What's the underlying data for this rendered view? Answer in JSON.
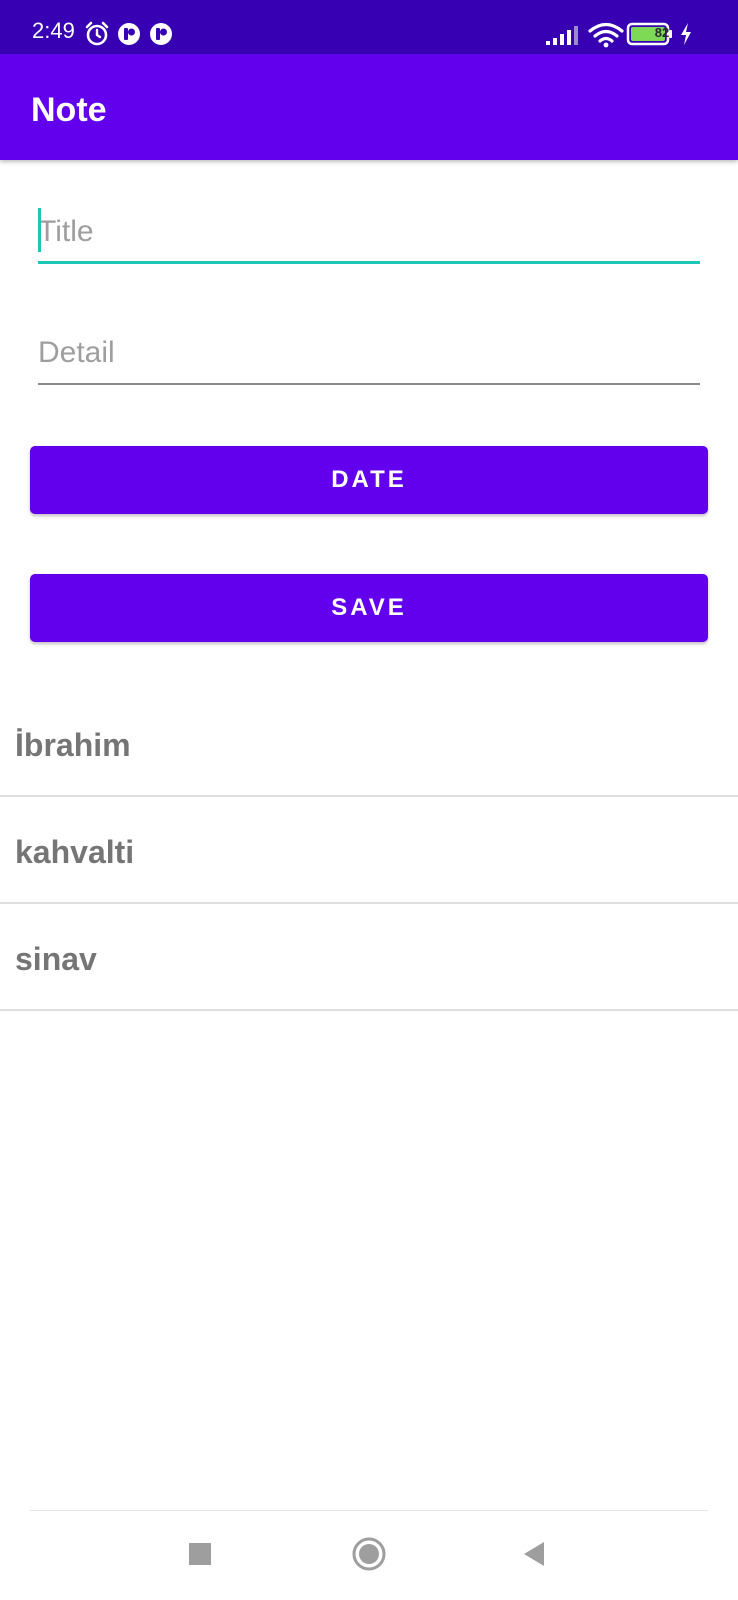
{
  "status_bar": {
    "time": "2:49",
    "battery_level": "82",
    "icons_left": [
      "alarm-icon",
      "notification-app-icon",
      "notification-app-icon"
    ],
    "icons_right": [
      "signal-icon",
      "wifi-icon",
      "battery-icon",
      "charging-icon"
    ],
    "background_color": "#3700b3"
  },
  "app_bar": {
    "title": "Note",
    "background_color": "#6200ee"
  },
  "form": {
    "title_field": {
      "placeholder": "Title",
      "value": "",
      "focused": true,
      "accent_color": "#1cc7b8"
    },
    "detail_field": {
      "placeholder": "Detail",
      "value": ""
    },
    "date_button_label": "DATE",
    "save_button_label": "SAVE"
  },
  "notes": [
    {
      "title": "İbrahim"
    },
    {
      "title": "kahvalti"
    },
    {
      "title": "sinav"
    }
  ],
  "navigation_bar": {
    "buttons": [
      "recents-icon",
      "home-icon",
      "back-icon"
    ]
  }
}
